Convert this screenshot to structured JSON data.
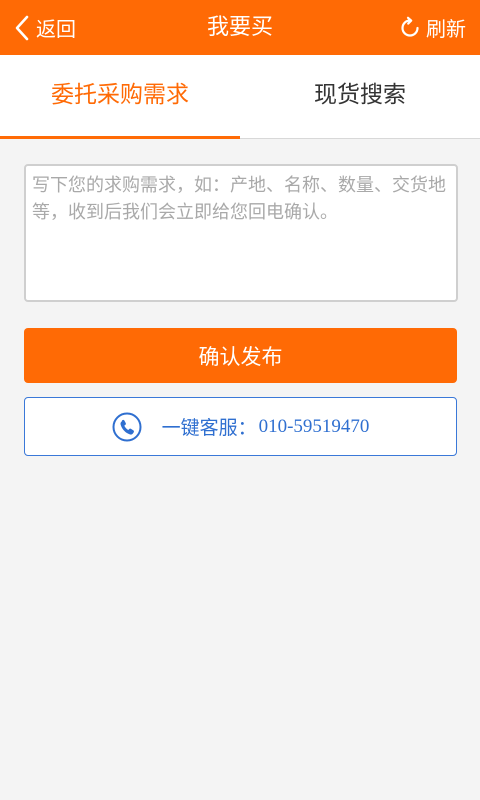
{
  "header": {
    "back_label": "返回",
    "title": "我要买",
    "refresh_label": "刷新",
    "bar_color": "#ff6a05"
  },
  "tabs": [
    {
      "label": "委托采购需求",
      "active": true
    },
    {
      "label": "现货搜索",
      "active": false
    }
  ],
  "request_form": {
    "value": "",
    "placeholder": "写下您的求购需求，如：产地、名称、数量、交货地等，收到后我们会立即给您回电确认。"
  },
  "confirm_button": {
    "label": "确认发布"
  },
  "service": {
    "label": "一键客服：",
    "phone": "010-59519470",
    "icon": "phone-icon",
    "color": "#2f6fd0"
  }
}
